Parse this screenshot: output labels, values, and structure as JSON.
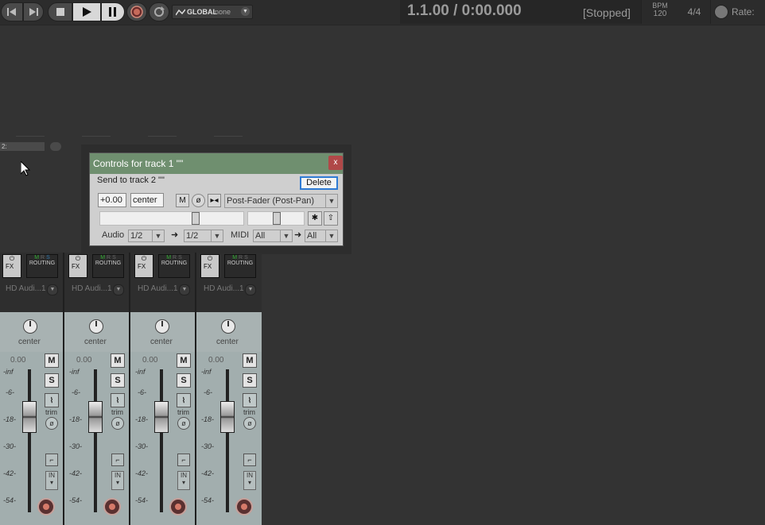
{
  "transport": {
    "automation_mode": "GLOBAL",
    "automation_value": "none",
    "position": "1.1.00 / 0:00.000",
    "status": "[Stopped]",
    "bpm_label": "BPM",
    "bpm_value": "120",
    "time_signature": "4/4",
    "rate_label": "Rate:"
  },
  "track2_label": "2:",
  "dialog": {
    "title": "Controls for track 1 \"\"",
    "close": "x",
    "send_label": "Send to track 2 \"\"",
    "delete": "Delete",
    "volume": "+0.00",
    "pan": "center",
    "mute": "M",
    "mode": "Post-Fader (Post-Pan)",
    "audio_label": "Audio",
    "audio_src": "1/2",
    "audio_dst": "1/2",
    "midi_label": "MIDI",
    "midi_src": "All",
    "midi_dst": "All"
  },
  "strips": [
    {
      "fx": "FX",
      "routing": "ROUTING",
      "hw": "HD Audi...1",
      "pan": "center",
      "vol": "0.00",
      "mute": "M",
      "solo": "S",
      "trim": "trim",
      "in": "IN"
    },
    {
      "fx": "FX",
      "routing": "ROUTING",
      "hw": "HD Audi...1",
      "pan": "center",
      "vol": "0.00",
      "mute": "M",
      "solo": "S",
      "trim": "trim",
      "in": "IN"
    },
    {
      "fx": "FX",
      "routing": "ROUTING",
      "hw": "HD Audi...1",
      "pan": "center",
      "vol": "0.00",
      "mute": "M",
      "solo": "S",
      "trim": "trim",
      "in": "IN"
    },
    {
      "fx": "FX",
      "routing": "ROUTING",
      "hw": "HD Audi...1",
      "pan": "center",
      "vol": "0.00",
      "mute": "M",
      "solo": "S",
      "trim": "trim",
      "in": "IN"
    }
  ],
  "meter_scale": [
    "-inf",
    "-6-",
    "-18-",
    "-30-",
    "-42-",
    "-54-"
  ],
  "colors": {
    "background": "#333333",
    "dialog_title": "#6f8f6f",
    "close_button": "#b04848",
    "focus_border": "#2f7bd4",
    "strip_panel": "#a2aeae"
  }
}
